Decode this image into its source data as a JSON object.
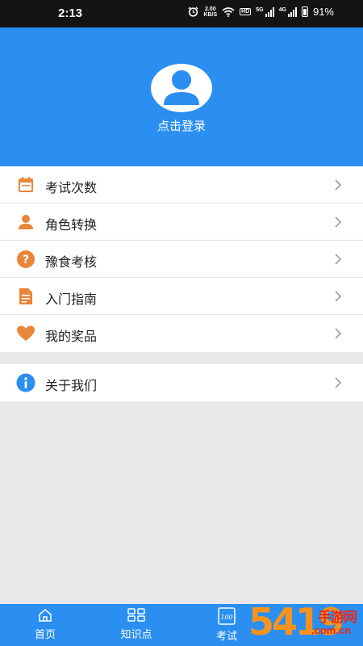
{
  "status_bar": {
    "time": "2:13",
    "net_speed_value": "2.00",
    "net_speed_unit": "KB/S",
    "hd_badge": "HD",
    "sim1_label": "5G",
    "sim2_label": "4G",
    "battery": "91%"
  },
  "profile": {
    "login_text": "点击登录"
  },
  "menu": {
    "items": [
      {
        "label": "考试次数",
        "icon": "calendar-icon",
        "color": "#e9863a"
      },
      {
        "label": "角色转换",
        "icon": "person-icon",
        "color": "#e9863a"
      },
      {
        "label": "豫食考核",
        "icon": "question-icon",
        "color": "#e9863a"
      },
      {
        "label": "入门指南",
        "icon": "document-icon",
        "color": "#e9863a"
      },
      {
        "label": "我的奖品",
        "icon": "heart-icon",
        "color": "#e9863a"
      }
    ],
    "about": {
      "label": "关于我们",
      "icon": "info-icon",
      "color": "#2a8ff0"
    }
  },
  "tabbar": {
    "tabs": [
      {
        "label": "首页",
        "icon": "home-icon"
      },
      {
        "label": "知识点",
        "icon": "grid-icon"
      },
      {
        "label": "考试",
        "icon": "exam-icon"
      }
    ]
  },
  "watermark": {
    "digits": "5419",
    "text": "手游网",
    "domain": ".com.cn"
  },
  "colors": {
    "primary": "#2a8ff0",
    "accent": "#e9863a",
    "background": "#e9e9ec"
  }
}
